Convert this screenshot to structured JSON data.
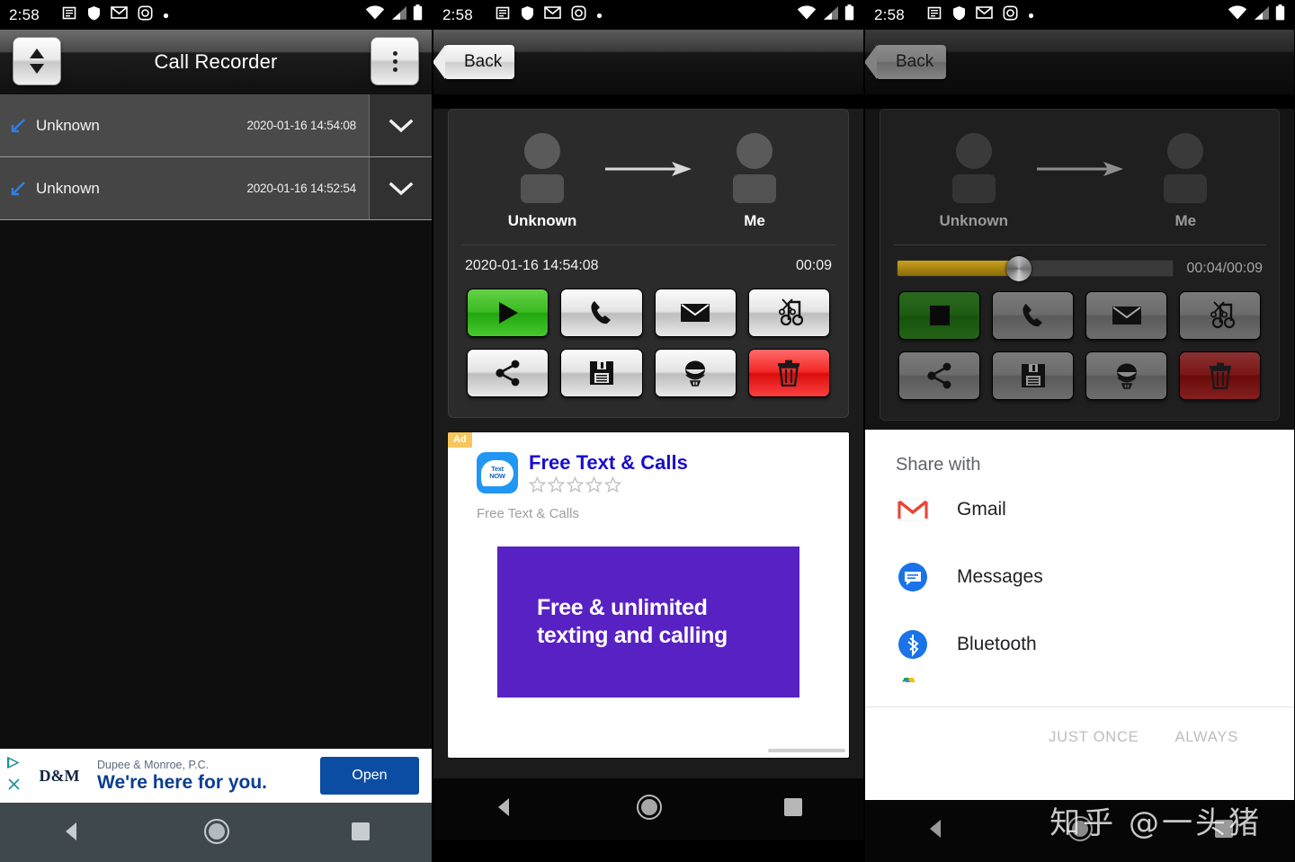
{
  "status_bar": {
    "time": "2:58",
    "left_icons": [
      "news-icon",
      "shield-icon",
      "gmail-icon",
      "instagram-icon",
      "dot-icon"
    ],
    "right_icons": [
      "wifi-icon",
      "cell-signal-icon",
      "battery-icon"
    ]
  },
  "panel1": {
    "title": "Call Recorder",
    "sort_button": "sort-icon",
    "overflow_button": "overflow-menu-icon",
    "rows": [
      {
        "direction": "incoming",
        "name": "Unknown",
        "date": "2020-01-16 14:54:08",
        "expand": "chevron-down-icon"
      },
      {
        "direction": "incoming",
        "name": "Unknown",
        "date": "2020-01-16 14:52:54",
        "expand": "chevron-down-icon"
      }
    ],
    "ad": {
      "advertiser": "Dupee & Monroe, P.C.",
      "logo": "D&M",
      "headline": "We're here for you.",
      "cta": "Open",
      "info_icon": "ad-choices-icon",
      "close_icon": "close-icon"
    }
  },
  "panel2": {
    "back_label": "Back",
    "caller": "Unknown",
    "callee": "Me",
    "arrow": "right-arrow-icon",
    "date": "2020-01-16 14:54:08",
    "duration": "00:09",
    "buttons": [
      {
        "name": "play-button",
        "icon": "play-icon",
        "style": "green"
      },
      {
        "name": "call-button",
        "icon": "phone-icon",
        "style": "silver"
      },
      {
        "name": "email-button",
        "icon": "envelope-icon",
        "style": "silver"
      },
      {
        "name": "trim-button",
        "icon": "scissors-music-icon",
        "style": "silver"
      },
      {
        "name": "share-button",
        "icon": "share-icon",
        "style": "silver"
      },
      {
        "name": "save-button",
        "icon": "floppy-disk-icon",
        "style": "silver"
      },
      {
        "name": "robot-button",
        "icon": "robot-icon",
        "style": "silver"
      },
      {
        "name": "delete-button",
        "icon": "trash-icon",
        "style": "red"
      }
    ],
    "ad": {
      "badge": "Ad",
      "icon_label_top": "Text",
      "icon_label_bottom": "NOW",
      "title": "Free Text & Calls",
      "stars": 5,
      "subtitle": "Free Text & Calls",
      "promo_line1": "Free & unlimited",
      "promo_line2": "texting and calling"
    }
  },
  "panel3": {
    "back_label": "Back",
    "caller": "Unknown",
    "callee": "Me",
    "arrow": "right-arrow-icon",
    "progress_percent": 44,
    "time_display": "00:04/00:09",
    "buttons": [
      {
        "name": "stop-button",
        "icon": "stop-icon",
        "style": "green"
      },
      {
        "name": "call-button",
        "icon": "phone-icon",
        "style": "silver"
      },
      {
        "name": "email-button",
        "icon": "envelope-icon",
        "style": "silver"
      },
      {
        "name": "trim-button",
        "icon": "scissors-music-icon",
        "style": "silver"
      },
      {
        "name": "share-button",
        "icon": "share-icon",
        "style": "silver"
      },
      {
        "name": "save-button",
        "icon": "floppy-disk-icon",
        "style": "silver"
      },
      {
        "name": "robot-button",
        "icon": "robot-icon",
        "style": "silver"
      },
      {
        "name": "delete-button",
        "icon": "trash-icon",
        "style": "red"
      }
    ],
    "share_sheet": {
      "title": "Share with",
      "items": [
        {
          "label": "Gmail",
          "icon": "gmail-icon"
        },
        {
          "label": "Messages",
          "icon": "messages-icon"
        },
        {
          "label": "Bluetooth",
          "icon": "bluetooth-icon"
        },
        {
          "label": "",
          "icon": "google-drive-icon"
        }
      ],
      "just_once": "JUST ONCE",
      "always": "ALWAYS"
    }
  },
  "nav_bar": {
    "back": "nav-back-icon",
    "home": "nav-home-icon",
    "recents": "nav-recents-icon"
  },
  "watermark": "知乎 @一头猪",
  "colors": {
    "accent_green": "#3cbb22",
    "accent_red": "#f32727",
    "ad_blue": "#0b4da2",
    "promo_purple": "#5821c4",
    "seek_gold": "#c9a11d",
    "incoming_arrow": "#2f7fe0"
  }
}
